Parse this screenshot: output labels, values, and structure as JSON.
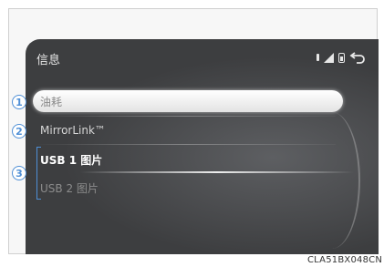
{
  "screen": {
    "title": "信息",
    "items": [
      {
        "label": "油耗"
      },
      {
        "label": "MirrorLink™"
      },
      {
        "label": "USB 1 图片"
      },
      {
        "label": "USB 2 图片"
      }
    ]
  },
  "status_icons": [
    "dot-icon",
    "signal-icon",
    "battery-icon",
    "back-icon"
  ],
  "callouts": [
    "1",
    "2",
    "3"
  ],
  "caption": "CLA51BX048CN",
  "colors": {
    "screen_bg": "#3d3e40",
    "callout_accent": "#4f8fd6",
    "selected_bg": "#f0f0f0"
  }
}
